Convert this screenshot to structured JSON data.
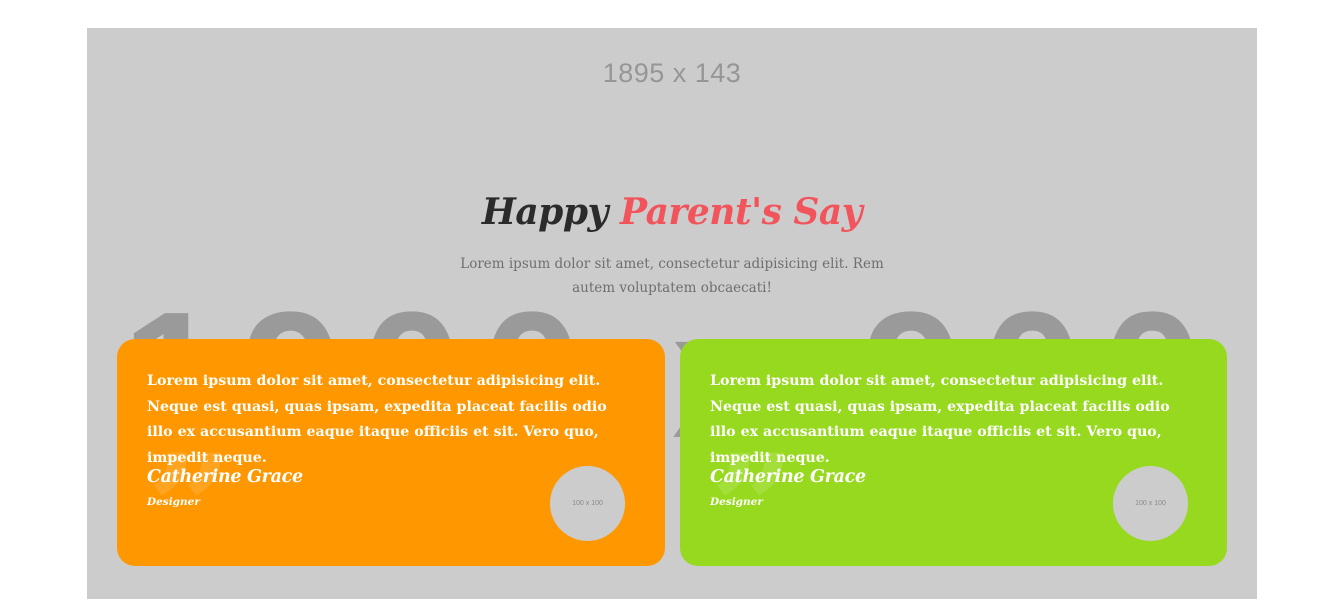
{
  "background": {
    "top_placeholder": "1895 x 143",
    "big_placeholder": "1900 x 900",
    "color": "#cccccc"
  },
  "header": {
    "title_main": "Happy",
    "title_accent": "Parent's Say",
    "accent_color": "#f2545b",
    "subtitle": "Lorem ipsum dolor sit amet, consectetur adipisicing elit. Rem autem voluptatem obcaecati!"
  },
  "testimonials": [
    {
      "text": "Lorem ipsum dolor sit amet, consectetur adipisicing elit. Neque est quasi, quas ipsam, expedita placeat facilis odio illo ex accusantium eaque itaque officiis et sit. Vero quo, impedit neque.",
      "name": "Catherine Grace",
      "role": "Designer",
      "avatar_placeholder": "100 x 100",
      "color": "#ff9700",
      "icon": "quote-icon"
    },
    {
      "text": "Lorem ipsum dolor sit amet, consectetur adipisicing elit. Neque est quasi, quas ipsam, expedita placeat facilis odio illo ex accusantium eaque itaque officiis et sit. Vero quo, impedit neque.",
      "name": "Catherine Grace",
      "role": "Designer",
      "avatar_placeholder": "100 x 100",
      "color": "#96d91e",
      "icon": "quote-icon"
    }
  ]
}
